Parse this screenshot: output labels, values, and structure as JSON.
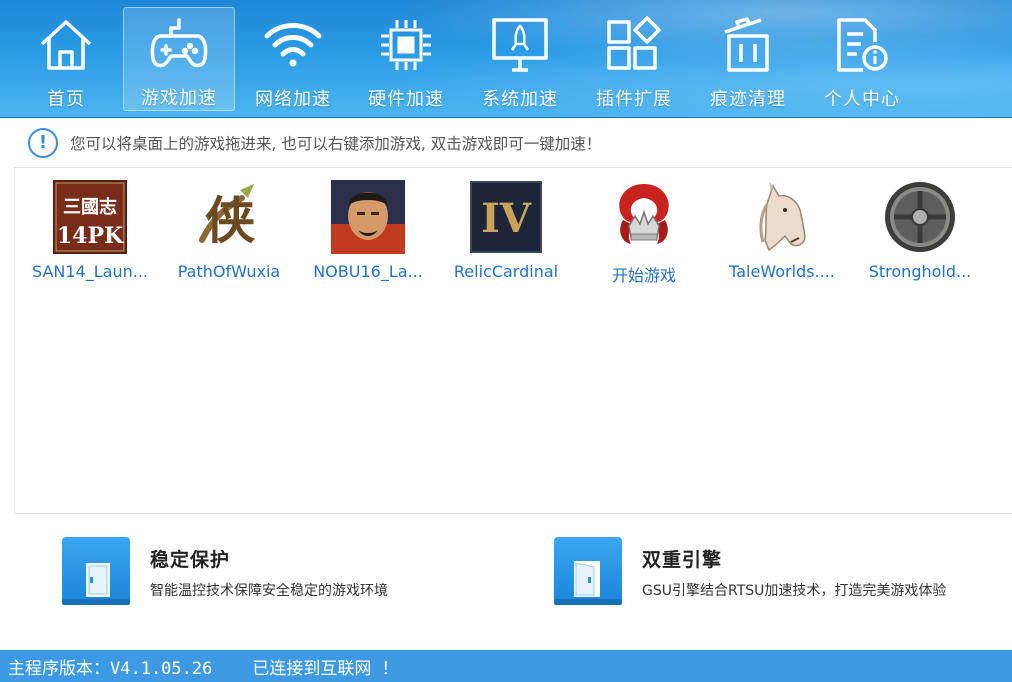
{
  "toolbar": {
    "items": [
      {
        "label": "首页",
        "icon": "home-icon"
      },
      {
        "label": "游戏加速",
        "icon": "gamepad-icon",
        "active": true
      },
      {
        "label": "网络加速",
        "icon": "wifi-icon"
      },
      {
        "label": "硬件加速",
        "icon": "chip-icon"
      },
      {
        "label": "系统加速",
        "icon": "monitor-rocket-icon"
      },
      {
        "label": "插件扩展",
        "icon": "plugin-grid-icon"
      },
      {
        "label": "痕迹清理",
        "icon": "trash-icon"
      },
      {
        "label": "个人中心",
        "icon": "user-document-icon"
      }
    ]
  },
  "hint": {
    "text": "您可以将桌面上的游戏拖进来, 也可以右键添加游戏, 双击游戏即可一键加速！",
    "icon": "info-icon"
  },
  "games": [
    {
      "label": "SAN14_Laun...",
      "icon": "san14-game-icon",
      "icon_text": "三國志 14PK"
    },
    {
      "label": "PathOfWuxia",
      "icon": "pathofwuxia-game-icon",
      "icon_text": "侠"
    },
    {
      "label": "NOBU16_La...",
      "icon": "nobu16-game-icon"
    },
    {
      "label": "RelicCardinal",
      "icon": "reliccardinal-game-icon",
      "icon_text": "IV"
    },
    {
      "label": "开始游戏",
      "icon": "start-game-icon"
    },
    {
      "label": "TaleWorlds....",
      "icon": "taleworlds-horse-icon"
    },
    {
      "label": "Stronghold...",
      "icon": "stronghold-shield-icon"
    }
  ],
  "features": [
    {
      "title": "稳定保护",
      "desc": "智能温控技术保障安全稳定的游戏环境",
      "icon": "door-icon"
    },
    {
      "title": "双重引擎",
      "desc": "GSU引擎结合RTSU加速技术，打造完美游戏体验",
      "icon": "door-open-icon"
    }
  ],
  "status": {
    "version": "主程序版本：V4.1.05.26",
    "connection": "已连接到互联网 ！"
  },
  "colors": {
    "toolbar_blue": "#2a9be6",
    "status_blue": "#3d9ae2",
    "link_blue": "#2570c4"
  }
}
